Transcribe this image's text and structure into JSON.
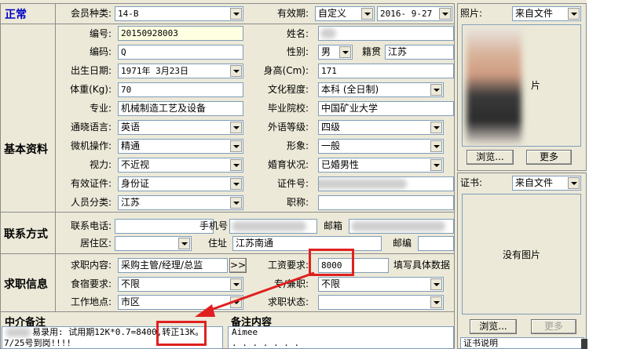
{
  "status": "正常",
  "sections": {
    "basic": "基本资料",
    "contact": "联系方式",
    "job": "求职信息",
    "agent_notes": "中介备注",
    "notes": "备注内容"
  },
  "basic": {
    "member_type_label": "会员种类:",
    "member_type": "14-B",
    "validity_label": "有效期:",
    "validity": "自定义",
    "validity_date": "2016- 9-27",
    "no_label": "编号:",
    "no": "20150928003",
    "name_label": "姓名:",
    "code_label": "编码:",
    "code": "Q",
    "gender_label": "性别:",
    "gender": "男",
    "native_label": "籍贯",
    "native": "江苏",
    "birth_label": "出生日期:",
    "birth": "1971年 3月23日",
    "height_label": "身高(Cm):",
    "height": "171",
    "weight_label": "体重(Kg):",
    "weight": "70",
    "edu_label": "文化程度:",
    "edu": "本科 (全日制)",
    "major_label": "专业:",
    "major": "机械制造工艺及设备",
    "school_label": "毕业院校:",
    "school": "中国矿业大学",
    "lang_label": "通晓语言:",
    "lang": "英语",
    "foreign_label": "外语等级:",
    "foreign": "四级",
    "pc_label": "微机操作:",
    "pc": "精通",
    "look_label": "形象:",
    "look": "一般",
    "vision_label": "视力:",
    "vision": "不近视",
    "marriage_label": "婚育状况:",
    "marriage": "已婚男性",
    "idtype_label": "有效证件:",
    "idtype": "身份证",
    "idno_label": "证件号:",
    "category_label": "人员分类:",
    "category": "江苏",
    "title_label": "职称:"
  },
  "contact": {
    "phone_label": "联系电话:",
    "mobile_label": "手机号",
    "email_label": "邮箱",
    "area_label": "居住区:",
    "address_label": "住址",
    "address": "江苏南通",
    "zip_label": "邮编"
  },
  "job": {
    "content_label": "求职内容:",
    "content": "采购主管/经理/总监",
    "more": ">>",
    "salary_label": "工资要求:",
    "salary": "8000",
    "salary_hint": "填写具体数据",
    "board_label": "食宿要求:",
    "board": "不限",
    "parttime_label": "专/兼职:",
    "parttime": "不限",
    "place_label": "工作地点:",
    "place": "市区",
    "jobstatus_label": "求职状态:"
  },
  "notes": {
    "agent_line1_a": "易录用: 试用期12K*0.7=8400,",
    "agent_line1_b": "转正13K。",
    "agent_line2": "7/25号到岗!!!!",
    "note_line1": "Aimee",
    "note_line2": ". . . . . . ."
  },
  "photo": {
    "label": "照片:",
    "source": "来自文件",
    "overlay_text": "片",
    "browse": "浏览...",
    "more": "更多"
  },
  "cert": {
    "label": "证书:",
    "source": "来自文件",
    "no_image": "没有图片",
    "browse": "浏览...",
    "more": "更多",
    "desc_label": "证书说明"
  },
  "colors": {
    "highlight_red": "#e02020",
    "title_blue": "#0000c8",
    "field_yellow": "#ffffe1"
  }
}
